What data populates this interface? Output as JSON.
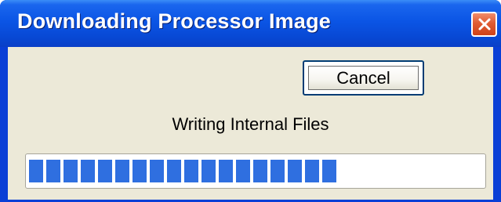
{
  "window": {
    "title": "Downloading Processor Image",
    "close_icon": "close-icon"
  },
  "dialog": {
    "cancel_label": "Cancel",
    "status_text": "Writing Internal Files"
  },
  "progress": {
    "value_fraction": 0.68,
    "segments_filled": 18
  },
  "colors": {
    "titlebar": "#0b55e5",
    "client_bg": "#ece9d8",
    "progress_segment": "#2f6fe0",
    "close_button": "#e05b32"
  }
}
